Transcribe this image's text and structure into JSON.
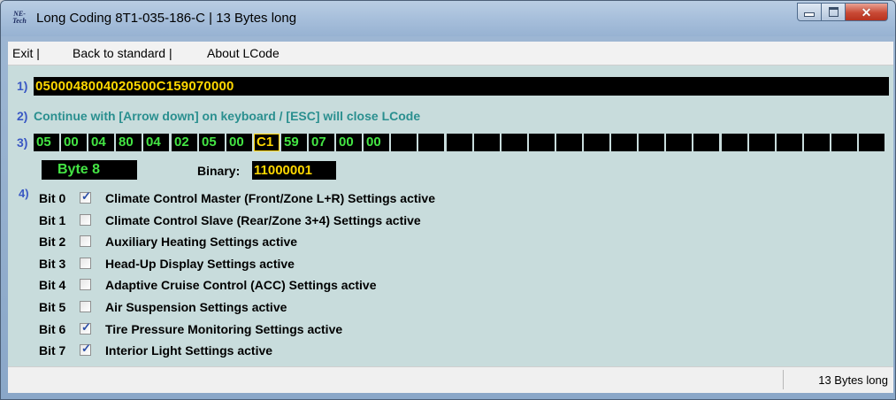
{
  "window": {
    "icon_text": "NE-Tech",
    "title": "Long Coding  8T1-035-186-C | 13 Bytes long"
  },
  "menu": {
    "items": [
      "Exit |",
      "Back to standard |",
      "About LCode"
    ]
  },
  "line1": {
    "number": "1)",
    "coding": "0500048004020500C159070000"
  },
  "line2": {
    "number": "2)",
    "hint": "Continue with [Arrow down] on keyboard / [ESC] will close LCode"
  },
  "line3": {
    "number": "3)",
    "bytes": [
      "05",
      "00",
      "04",
      "80",
      "04",
      "02",
      "05",
      "00",
      "C1",
      "59",
      "07",
      "00",
      "00",
      "",
      "",
      "",
      "",
      "",
      "",
      "",
      "",
      "",
      "",
      "",
      "",
      "",
      "",
      "",
      "",
      "",
      ""
    ],
    "selected_index": 8
  },
  "byte_info": {
    "byte_label": "Byte 8",
    "binary_label": "Binary:",
    "binary_value": "11000001"
  },
  "line4": {
    "number": "4)",
    "bits": [
      {
        "bit": "Bit 0",
        "checked": true,
        "label": "Climate Control Master (Front/Zone L+R) Settings active"
      },
      {
        "bit": "Bit 1",
        "checked": false,
        "label": "Climate Control Slave (Rear/Zone 3+4) Settings active"
      },
      {
        "bit": "Bit 2",
        "checked": false,
        "label": "Auxiliary Heating Settings active"
      },
      {
        "bit": "Bit 3",
        "checked": false,
        "label": "Head-Up Display Settings active"
      },
      {
        "bit": "Bit 4",
        "checked": false,
        "label": "Adaptive Cruise Control (ACC) Settings active"
      },
      {
        "bit": "Bit 5",
        "checked": false,
        "label": "Air Suspension Settings active"
      },
      {
        "bit": "Bit 6",
        "checked": true,
        "label": "Tire Pressure Monitoring Settings active"
      },
      {
        "bit": "Bit 7",
        "checked": true,
        "label": "Interior Light Settings active"
      }
    ]
  },
  "status": {
    "text": "13 Bytes long"
  },
  "colors": {
    "background": "#c8dcdc",
    "hex_text": "#ffd800",
    "byte_text": "#44e544",
    "hint_text": "#2a8f8f",
    "line_number": "#3a58c4"
  }
}
